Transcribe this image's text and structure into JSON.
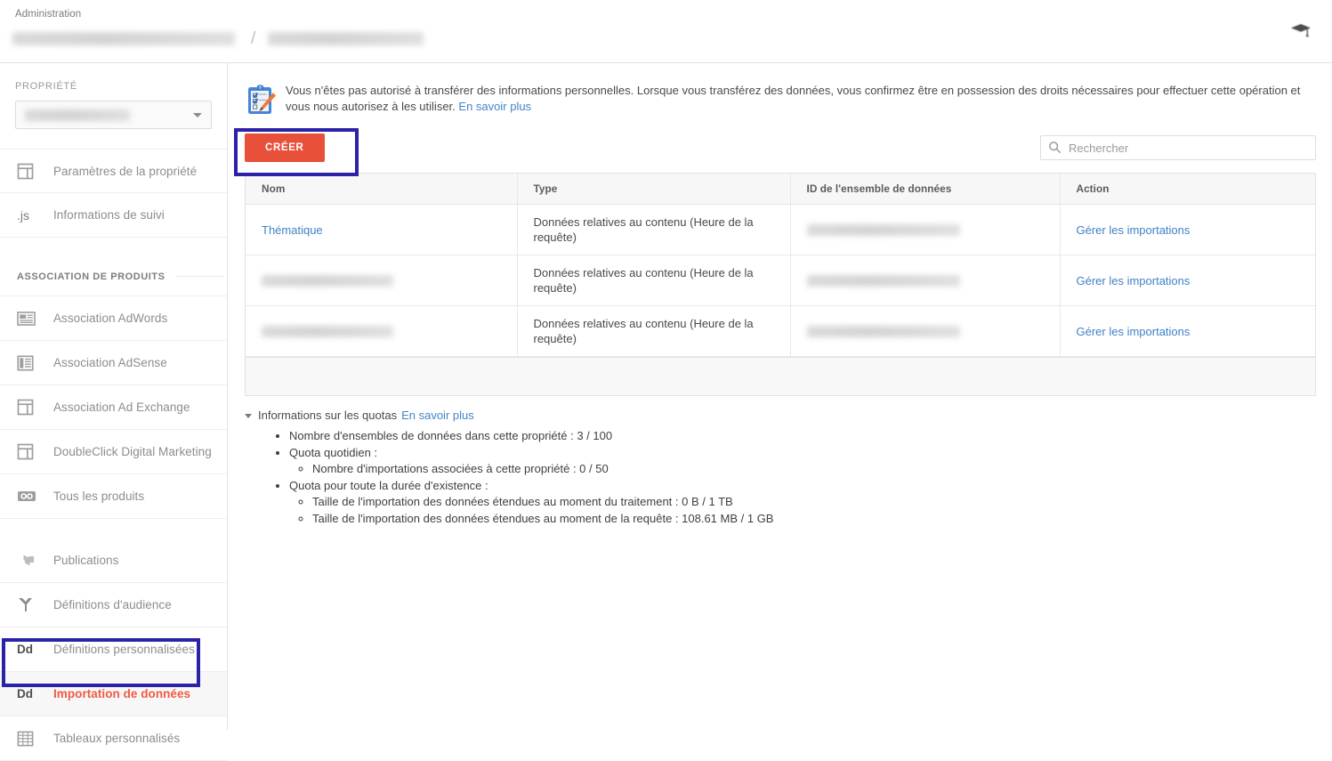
{
  "topbar": {
    "label": "Administration",
    "breadcrumb_separator": "/",
    "academy_icon": "graduation-cap-icon"
  },
  "sidebar": {
    "property_label": "PROPRIÉTÉ",
    "property_selected": "",
    "items": [
      {
        "label": "Paramètres de la propriété",
        "icon": "layout-panel-icon",
        "active": false
      },
      {
        "label": "Informations de suivi",
        "icon": "js-icon",
        "active": false
      }
    ],
    "section_label": "ASSOCIATION DE PRODUITS",
    "product_items": [
      {
        "label": "Association AdWords",
        "icon": "adwords-card-icon",
        "active": false
      },
      {
        "label": "Association AdSense",
        "icon": "adsense-list-icon",
        "active": false
      },
      {
        "label": "Association Ad Exchange",
        "icon": "layout-panel-icon",
        "active": false
      },
      {
        "label": "DoubleClick Digital Marketing",
        "icon": "layout-panel-icon",
        "active": false
      },
      {
        "label": "Tous les produits",
        "icon": "link-chain-icon",
        "active": false
      }
    ],
    "other_items": [
      {
        "label": "Publications",
        "icon": "share-arrows-icon",
        "active": false
      },
      {
        "label": "Définitions d'audience",
        "icon": "audience-branch-icon",
        "active": false
      },
      {
        "label": "Définitions personnalisées",
        "icon": "Dd",
        "active": false
      },
      {
        "label": "Importation de données",
        "icon": "Dd",
        "active": true
      },
      {
        "label": "Tableaux personnalisés",
        "icon": "grid-table-icon",
        "active": false
      }
    ]
  },
  "banner": {
    "icon": "clipboard-checklist-pencil-icon",
    "text": "Vous n'êtes pas autorisé à transférer des informations personnelles. Lorsque vous transférez des données, vous confirmez être en possession des droits nécessaires pour effectuer cette opération et vous nous autorisez à les utiliser.",
    "link_label": "En savoir plus"
  },
  "toolbar": {
    "create_label": "CRÉER",
    "create_color": "#e8503a",
    "search_placeholder": "Rechercher",
    "search_value": "",
    "search_icon": "search-icon"
  },
  "table": {
    "headers": [
      "Nom",
      "Type",
      "ID de l'ensemble de données",
      "Action"
    ],
    "rows": [
      {
        "name": "Thématique",
        "name_redacted": false,
        "type": "Données relatives au contenu (Heure de la requête)",
        "dataset_id": "",
        "dataset_id_redacted": true,
        "action": "Gérer les importations"
      },
      {
        "name": "",
        "name_redacted": true,
        "type": "Données relatives au contenu (Heure de la requête)",
        "dataset_id": "",
        "dataset_id_redacted": true,
        "action": "Gérer les importations"
      },
      {
        "name": "",
        "name_redacted": true,
        "type": "Données relatives au contenu (Heure de la requête)",
        "dataset_id": "",
        "dataset_id_redacted": true,
        "action": "Gérer les importations"
      }
    ]
  },
  "quota": {
    "title": "Informations sur les quotas",
    "link_label": "En savoir plus",
    "items": [
      {
        "text": "Nombre d'ensembles de données dans cette propriété : 3 / 100",
        "children": []
      },
      {
        "text": "Quota quotidien :",
        "children": [
          "Nombre d'importations associées à cette propriété : 0 / 50"
        ]
      },
      {
        "text": "Quota pour toute la durée d'existence :",
        "children": [
          "Taille de l'importation des données étendues au moment du traitement : 0 B / 1 TB",
          "Taille de l'importation des données étendues au moment de la requête : 108.61 MB / 1 GB"
        ]
      }
    ]
  },
  "annotations": {
    "color": "#2a22a8",
    "boxes": [
      "create-button-highlight",
      "sidebar-data-import-highlight"
    ]
  },
  "colors": {
    "link": "#3f82c4",
    "accent_red": "#e8503a",
    "active_text": "#ef5b43"
  }
}
